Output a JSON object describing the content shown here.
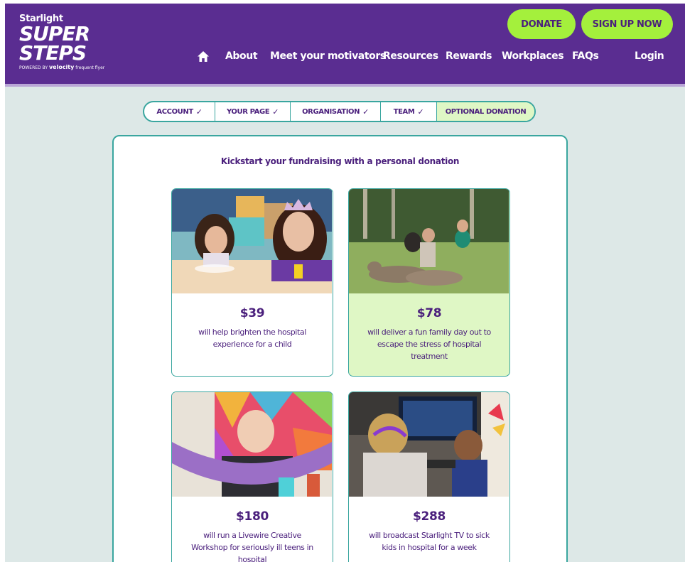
{
  "logo": {
    "top": "Starlight",
    "line1": "SUPER",
    "line2": "STEPS",
    "powered": "POWERED BY",
    "brand": "velocity",
    "brand_suffix": "frequent flyer"
  },
  "header": {
    "donate_label": "DONATE",
    "signup_label": "SIGN UP NOW"
  },
  "nav": {
    "items": [
      "About",
      "Meet your motivators",
      "Resources",
      "Rewards",
      "Workplaces",
      "FAQs"
    ],
    "login": "Login",
    "home_icon": "home-icon"
  },
  "steps": [
    {
      "label": "ACCOUNT",
      "done": true
    },
    {
      "label": "YOUR PAGE",
      "done": true
    },
    {
      "label": "ORGANISATION",
      "done": true
    },
    {
      "label": "TEAM",
      "done": true
    },
    {
      "label": "OPTIONAL DONATION",
      "done": false
    }
  ],
  "check_glyph": "✓",
  "card": {
    "title": "Kickstart your fundraising with a personal donation"
  },
  "options": [
    {
      "amount": "$39",
      "desc": "will help brighten the hospital experience for a child",
      "selected": false
    },
    {
      "amount": "$78",
      "desc": "will deliver a fun family day out to escape the stress of hospital treatment",
      "selected": true
    },
    {
      "amount": "$180",
      "desc": "will run a Livewire Creative Workshop for seriously ill teens in hospital",
      "selected": false
    },
    {
      "amount": "$288",
      "desc": "will broadcast Starlight TV  to sick kids in hospital for  a week",
      "selected": false
    }
  ],
  "colors": {
    "header": "#5a2d91",
    "accent_green": "#a4f03c",
    "teal": "#3aa69f",
    "page_bg": "#dde8e7",
    "selected_bg": "#dff7c5"
  }
}
